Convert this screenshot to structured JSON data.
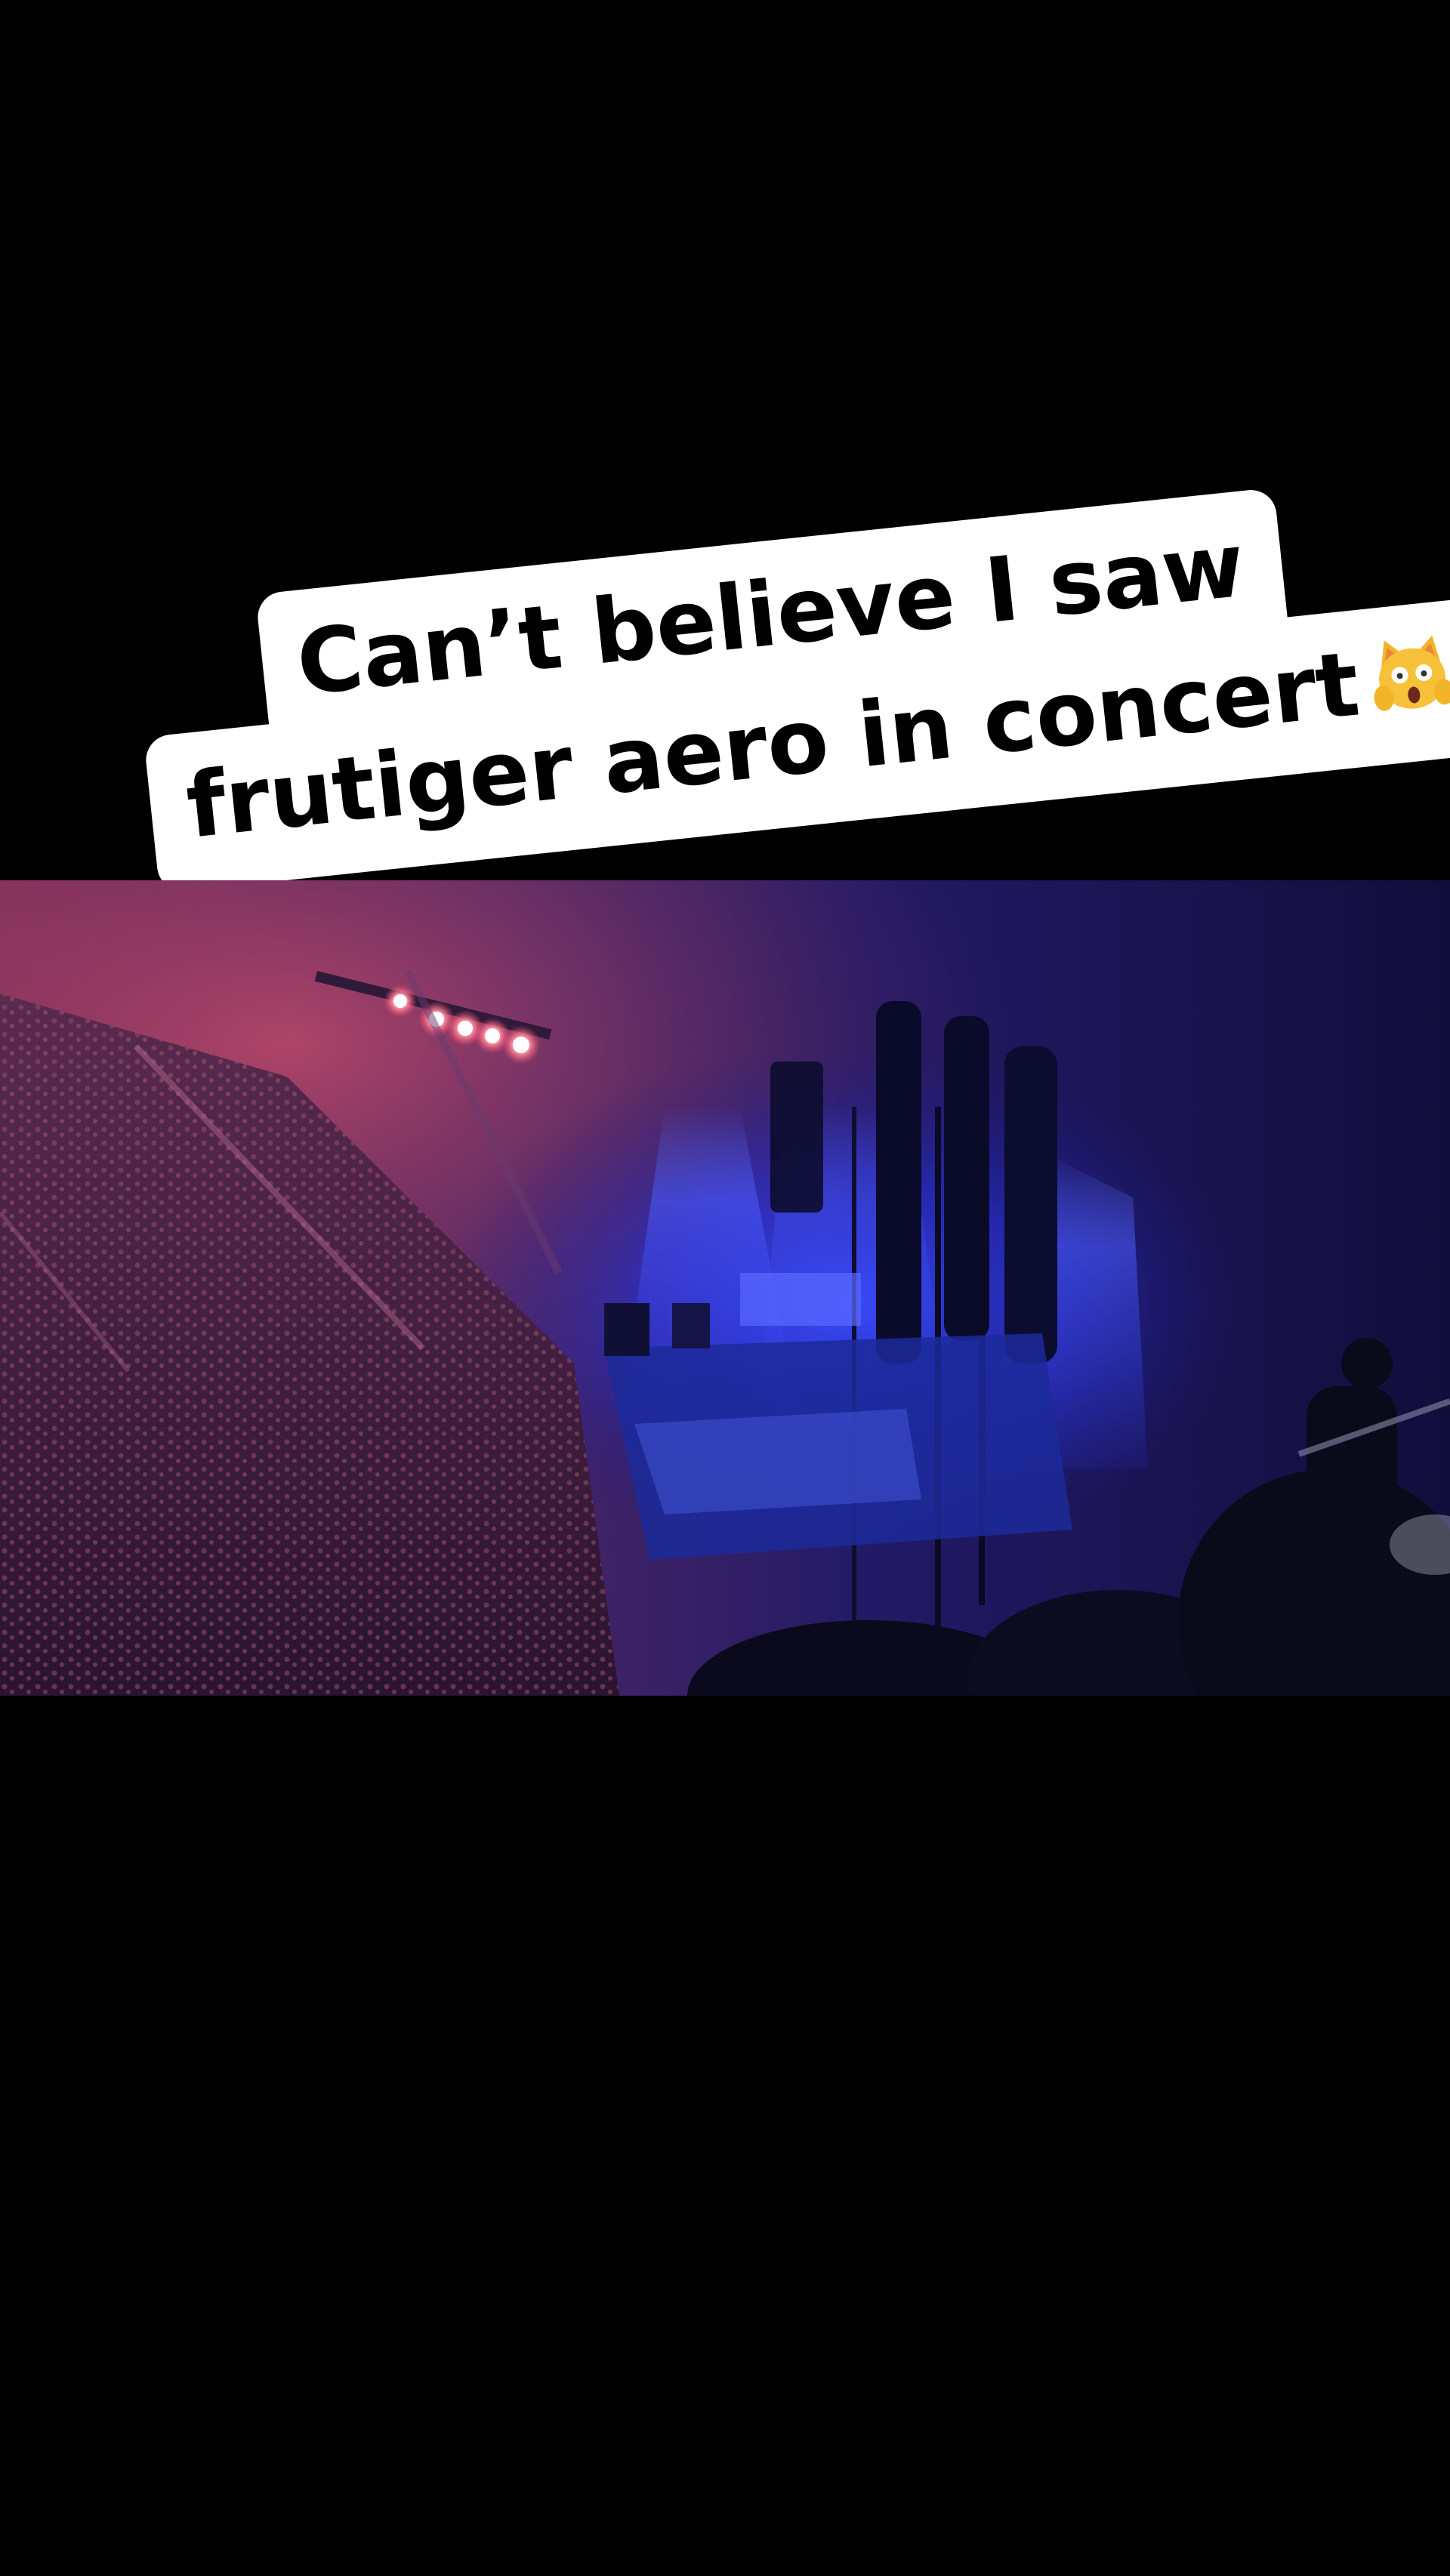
{
  "caption": {
    "line1": "Can’t believe I saw",
    "line2": "frutiger aero in concert",
    "emoji_icon": "weary-cat-face-icon",
    "background_color": "#ffffff",
    "text_color": "#000000"
  },
  "photo": {
    "subject": "concert-arena-photo",
    "stage_light_color": "#2a3cff",
    "crowd_light_color": "#c2506a",
    "background_color": "#000000"
  }
}
